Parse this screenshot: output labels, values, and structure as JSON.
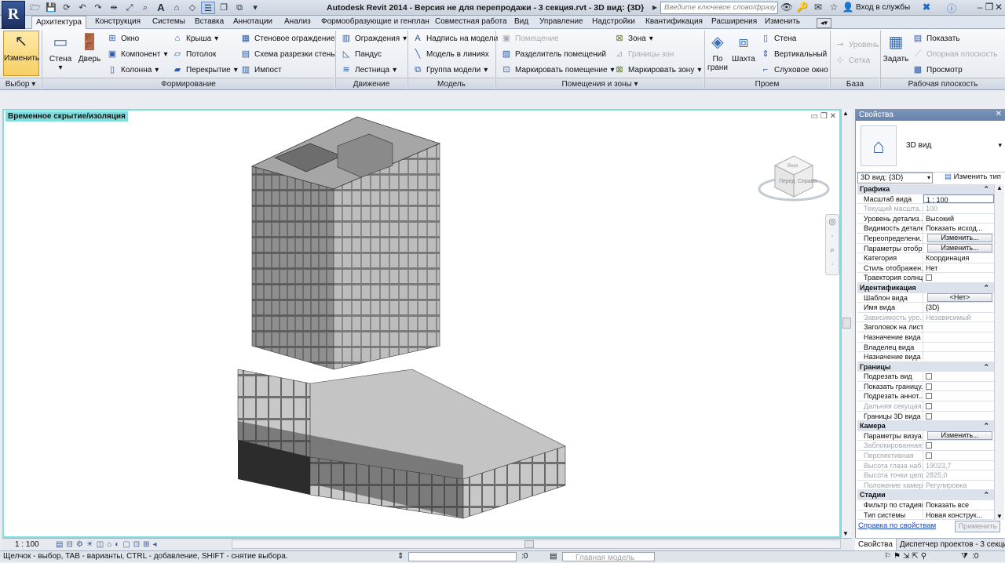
{
  "app": {
    "title": "Autodesk Revit 2014 - Версия не для перепродажи -    3 секция.rvt - 3D вид: {3D}",
    "search_placeholder": "Введите ключевое слово/фразу",
    "signin": "Вход в службы",
    "logo": "R"
  },
  "tabs": [
    "Архитектура",
    "Конструкция",
    "Системы",
    "Вставка",
    "Аннотации",
    "Анализ",
    "Формообразующие и генплан",
    "Совместная работа",
    "Вид",
    "Управление",
    "Надстройки",
    "Квантификация",
    "Расширения",
    "Изменить"
  ],
  "ribbon": {
    "modify": "Изменить",
    "wall": "Стена",
    "door": "Дверь",
    "window": "Окно",
    "component": "Компонент",
    "column": "Колонна",
    "roof": "Крыша",
    "ceiling": "Потолок",
    "floor": "Перекрытие",
    "curtain_system": "Стеновое ограждение",
    "curtain_grid": "Схема разрезки стены",
    "mullion": "Импост",
    "railing": "Ограждения",
    "ramp": "Пандус",
    "stair": "Лестница",
    "model_text": "Надпись на модели",
    "model_line": "Модель в линиях",
    "model_group": "Группа модели",
    "room": "Помещение",
    "room_separator": "Разделитель помещений",
    "tag_room": "Маркировать помещение",
    "area": "Зона",
    "area_boundary": "Границы зон",
    "tag_area": "Маркировать зону",
    "by_face": "По грани",
    "shaft": "Шахта",
    "wall_opening": "Стена",
    "vertical": "Вертикальный",
    "dormer": "Слуховое окно",
    "level": "Уровень",
    "grid": "Сетка",
    "set": "Задать",
    "show": "Показать",
    "ref_plane": "Опорная плоскость",
    "viewer": "Просмотр",
    "panels": {
      "select": "Выбор",
      "build": "Формирование",
      "circulation": "Движение",
      "model": "Модель",
      "room_area": "Помещения и зоны",
      "opening": "Проем",
      "datum": "База",
      "work_plane": "Рабочая плоскость"
    }
  },
  "viewport": {
    "label": "Временное скрытие/изоляция",
    "cube_front": "Перед",
    "cube_right": "Справа",
    "cube_top": "Верх"
  },
  "status": {
    "scale": "1 : 100",
    "hint": "Щелчок - выбор, TAB - варианты, CTRL - добавление, SHIFT - снятие выбора.",
    "selection_count": ":0",
    "model_name": "Главная модель",
    "filter_count": ":0"
  },
  "properties": {
    "title": "Свойства",
    "type_name": "3D вид",
    "type_selector": "3D вид: {3D}",
    "edit_type": "Изменить тип",
    "rows": [
      {
        "kind": "group",
        "k": "Графика"
      },
      {
        "k": "Масштаб вида",
        "v": "1 : 100",
        "input": true
      },
      {
        "k": "Текущий масшта...",
        "v": "100",
        "dis": true
      },
      {
        "k": "Уровень детализ...",
        "v": "Высокий"
      },
      {
        "k": "Видимость деталей",
        "v": "Показать исход..."
      },
      {
        "k": "Переопределени...",
        "btn": "Изменить..."
      },
      {
        "k": "Параметры отобр...",
        "btn": "Изменить..."
      },
      {
        "k": "Категория",
        "v": "Координация"
      },
      {
        "k": "Стиль отображен...",
        "v": "Нет"
      },
      {
        "k": "Траектория солнца",
        "chk": true
      },
      {
        "kind": "group",
        "k": "Идентификация"
      },
      {
        "k": "Шаблон вида",
        "btn": "<Нет>"
      },
      {
        "k": "Имя вида",
        "v": "{3D}"
      },
      {
        "k": "Зависимость уро...",
        "v": "Независимый",
        "dis": true
      },
      {
        "k": "Заголовок на листе",
        "v": ""
      },
      {
        "k": "Назначение вида",
        "v": ""
      },
      {
        "k": "Владелец вида",
        "v": ""
      },
      {
        "k": "Назначение вида",
        "v": ""
      },
      {
        "kind": "group",
        "k": "Границы"
      },
      {
        "k": "Подрезать вид",
        "chk": true
      },
      {
        "k": "Показать границу...",
        "chk": true
      },
      {
        "k": "Подрезать аннот...",
        "chk": true
      },
      {
        "k": "Дальняя секущая...",
        "chk": true,
        "dis": true
      },
      {
        "k": "Границы 3D вида",
        "chk": true
      },
      {
        "kind": "group",
        "k": "Камера"
      },
      {
        "k": "Параметры визуа...",
        "btn": "Изменить..."
      },
      {
        "k": "Заблокированная...",
        "chk": true,
        "dis": true
      },
      {
        "k": "Перспективная",
        "chk": true,
        "dis": true
      },
      {
        "k": "Высота глаза наб...",
        "v": "19023,7",
        "dis": true
      },
      {
        "k": "Высота точки цели",
        "v": "2825,0",
        "dis": true
      },
      {
        "k": "Положение камеры",
        "v": "Регулировка",
        "dis": true
      },
      {
        "kind": "group",
        "k": "Стадии"
      },
      {
        "k": "Фильтр по стадиям",
        "v": "Показать все"
      },
      {
        "k": "Тип системы",
        "v": "Новая конструк..."
      }
    ],
    "help": "Справка по свойствам",
    "apply": "Применить",
    "bottom_tabs": [
      "Свойства",
      "Диспетчер проектов - 3 секция.rvt"
    ]
  }
}
